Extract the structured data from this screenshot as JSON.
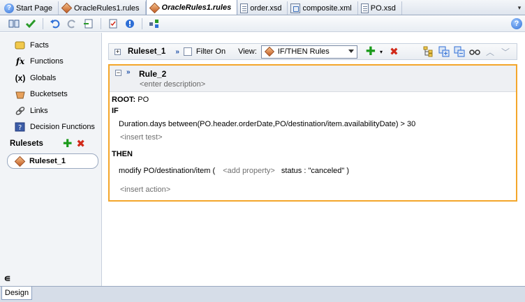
{
  "tabs": [
    {
      "label": "Start Page",
      "icon": "help-icon",
      "active": false
    },
    {
      "label": "OracleRules1.rules",
      "icon": "rules-diamond-icon",
      "active": false
    },
    {
      "label": "OracleRules1.rules",
      "icon": "rules-diamond-icon",
      "active": true
    },
    {
      "label": "order.xsd",
      "icon": "xsd-document-icon",
      "active": false
    },
    {
      "label": "composite.xml",
      "icon": "composite-icon",
      "active": false
    },
    {
      "label": "PO.xsd",
      "icon": "xsd-document-icon",
      "active": false
    }
  ],
  "sidebar": {
    "items": [
      {
        "label": "Facts",
        "icon": "facts-icon"
      },
      {
        "label": "Functions",
        "icon": "fx-icon"
      },
      {
        "label": "Globals",
        "icon": "globals-icon"
      },
      {
        "label": "Bucketsets",
        "icon": "bucketsets-icon"
      },
      {
        "label": "Links",
        "icon": "links-icon"
      },
      {
        "label": "Decision Functions",
        "icon": "decision-functions-icon"
      }
    ],
    "rulesets_title": "Rulesets",
    "ruleset_name": "Ruleset_1",
    "bottom_label": "Design"
  },
  "ruleset_toolbar": {
    "name": "Ruleset_1",
    "filter_label": "Filter On",
    "view_label": "View:",
    "view_value": "IF/THEN Rules"
  },
  "rule": {
    "name": "Rule_2",
    "description_placeholder": "<enter description>",
    "root_label": "ROOT:",
    "root_value": "PO",
    "if_label": "IF",
    "test_expression": "Duration.days between(PO.header.orderDate,PO/destination/item.availabilityDate)  >  30",
    "insert_test": "<insert test>",
    "then_label": "THEN",
    "action_prefix": "modify PO/destination/item (",
    "add_property": "<add property>",
    "action_suffix": "status : \"canceled\"  )",
    "insert_action": "<insert action>"
  },
  "colors": {
    "rule_border": "#f4a62a",
    "add_green": "#1a9a1a",
    "delete_red": "#d12a1a"
  }
}
